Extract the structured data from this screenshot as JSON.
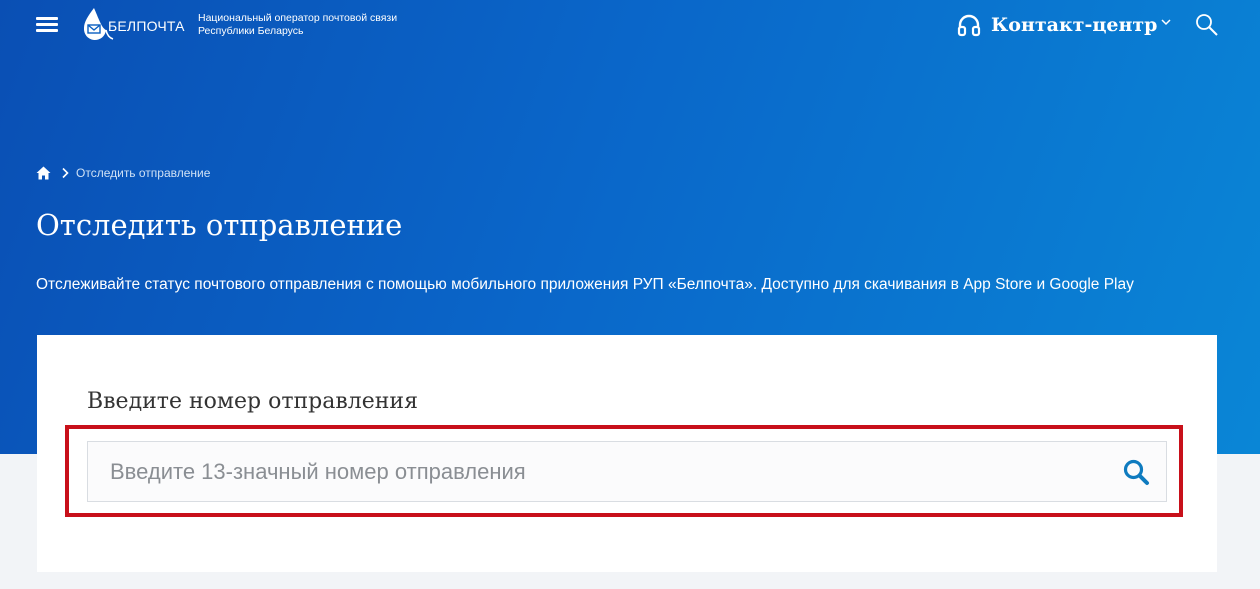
{
  "header": {
    "brand": "БЕЛПОЧТА",
    "tagline_line1": "Национальный оператор почтовой связи",
    "tagline_line2": "Республики Беларусь",
    "contact_label": "Контакт-центр",
    "icons": {
      "menu": "hamburger-menu-icon",
      "logo": "belpochta-logo",
      "contact": "headset-icon",
      "contact_dropdown": "chevron-down-icon",
      "search": "search-icon"
    }
  },
  "breadcrumb": {
    "home_icon": "home-icon",
    "separator_icon": "chevron-right-icon",
    "current": "Отследить отправление"
  },
  "page": {
    "title": "Отследить отправление",
    "subtitle": "Отслеживайте статус почтового отправления с помощью мобильного приложения РУП «Белпочта». Доступно для скачивания в App Store и Google Play"
  },
  "tracking": {
    "heading": "Введите номер отправления",
    "input_value": "",
    "input_placeholder": "Введите 13-значный номер отправления",
    "search_icon": "search-icon"
  },
  "colors": {
    "hero_start": "#0a4fb4",
    "hero_end": "#0a86d6",
    "highlight": "#c8101a",
    "search_button": "#0f7bbf"
  }
}
